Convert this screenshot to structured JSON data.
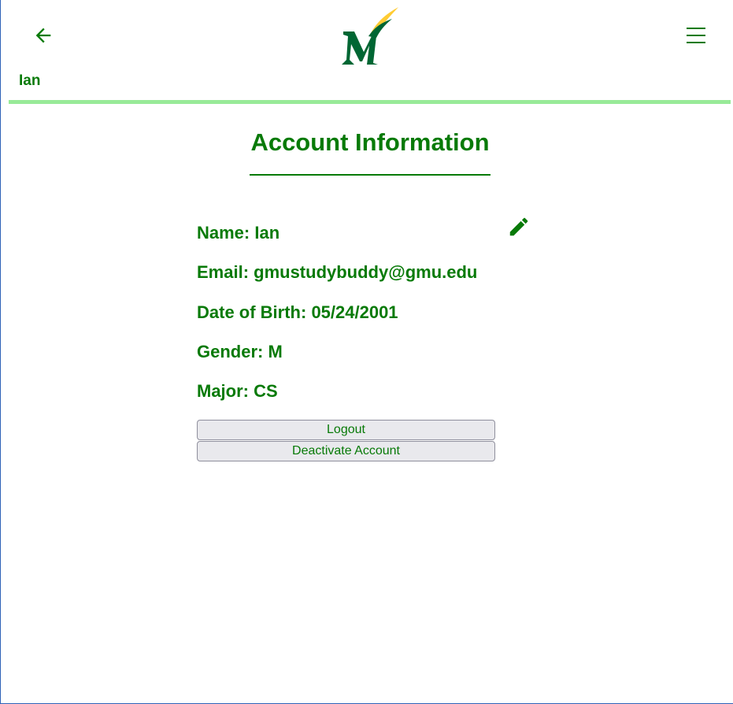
{
  "header": {
    "back_icon": "arrow-left-icon",
    "menu_icon": "hamburger-menu-icon",
    "logo": "gmu-logo",
    "username": "Ian",
    "accent_color": "#087a08",
    "rule_color": "#98ea98",
    "logo_colors": {
      "green": "#006633",
      "gold": "#ffcc33"
    }
  },
  "account": {
    "title": "Account Information",
    "edit_icon": "pencil-icon",
    "fields": {
      "name": "Name: Ian",
      "email": "Email: gmustudybuddy@gmu.edu",
      "dob": "Date of Birth: 05/24/2001",
      "gender": "Gender: M",
      "major": "Major: CS"
    },
    "logout_label": "Logout",
    "deactivate_label": "Deactivate Account"
  }
}
